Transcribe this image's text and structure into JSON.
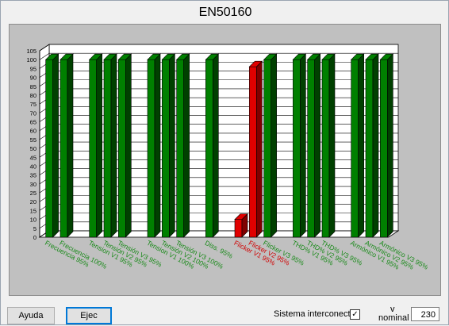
{
  "window": {
    "title": "EN50160"
  },
  "chart_data": {
    "type": "bar",
    "title": "EN50160",
    "xlabel": "",
    "ylabel": "",
    "ylim": [
      0,
      105
    ],
    "yticks": [
      0,
      5,
      10,
      15,
      20,
      25,
      30,
      35,
      40,
      45,
      50,
      55,
      60,
      65,
      70,
      75,
      80,
      85,
      90,
      95,
      100,
      105
    ],
    "grid": true,
    "categories": [
      "Frecuencia 95%",
      "Frecuencia 100%",
      "Tension V1 95%",
      "Tensión V2 95%",
      "Tensión V3 95%",
      "Tension V1 100%",
      "Tensión V2 100%",
      "Tensión V3 100%",
      "Diss. 95%",
      "Flicker V1 95%",
      "Flicker V2 95%",
      "Flicker V3 95%",
      "THD% V1 95%",
      "THD% V2 95%",
      "THD% V3 95%",
      "Armónico V1 95%",
      "Armónico V2 95%",
      "Armónico V3 95%"
    ],
    "values": [
      100,
      100,
      100,
      100,
      100,
      100,
      100,
      100,
      100,
      10,
      96,
      100,
      100,
      100,
      100,
      100,
      100,
      100
    ],
    "colors": [
      "#008000",
      "#008000",
      "#008000",
      "#008000",
      "#008000",
      "#008000",
      "#008000",
      "#008000",
      "#008000",
      "#e00000",
      "#e00000",
      "#008000",
      "#008000",
      "#008000",
      "#008000",
      "#008000",
      "#008000",
      "#008000"
    ],
    "slot_map": [
      0,
      1,
      3,
      4,
      5,
      7,
      8,
      9,
      11,
      13,
      14,
      15,
      17,
      18,
      19,
      21,
      22,
      23
    ]
  },
  "controls": {
    "ayuda_label": "Ayuda",
    "ejec_label": "Ejec",
    "sistema_label": "Sistema interconecta",
    "sistema_checked": "✓",
    "v_label": "v",
    "nominal_label": "nominal",
    "v_nominal_value": "230"
  }
}
